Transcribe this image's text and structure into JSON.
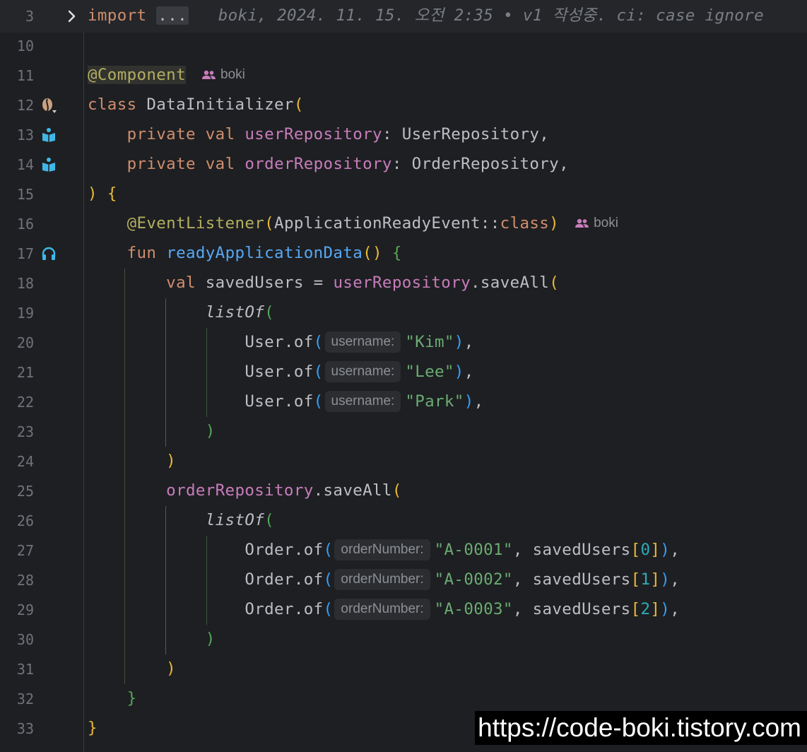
{
  "fold": {
    "line_number": "3",
    "keyword": "import",
    "dots": "...",
    "blame": "boki, 2024. 11. 15. 오전 2:35 • v1 작성중. ci: case ignore"
  },
  "lines": {
    "l10": "10",
    "l11": "11",
    "l12": "12",
    "l13": "13",
    "l14": "14",
    "l15": "15",
    "l16": "16",
    "l17": "17",
    "l18": "18",
    "l19": "19",
    "l20": "20",
    "l21": "21",
    "l22": "22",
    "l23": "23",
    "l24": "24",
    "l25": "25",
    "l26": "26",
    "l27": "27",
    "l28": "28",
    "l29": "29",
    "l30": "30",
    "l31": "31",
    "l32": "32",
    "l33": "33"
  },
  "code": {
    "component_ann": "@Component",
    "author": "boki",
    "class_kw": "class",
    "class_name": "DataInitializer",
    "private_kw": "private",
    "val_kw": "val",
    "user_repo": "userRepository",
    "user_repo_type": "UserRepository",
    "order_repo": "orderRepository",
    "order_repo_type": "OrderRepository",
    "event_ann": "@EventListener",
    "event_class": "ApplicationReadyEvent",
    "double_colon": "::",
    "class_ref": "class",
    "fun_kw": "fun",
    "fun_name": "readyApplicationData",
    "saved_users": "savedUsers",
    "save_all": "saveAll",
    "list_of": "listOf",
    "user_of": "User.of",
    "order_of": "Order.of",
    "hint_username": "username:",
    "hint_order_number": "orderNumber:",
    "str_kim": "\"Kim\"",
    "str_lee": "\"Lee\"",
    "str_park": "\"Park\"",
    "str_a1": "\"A-0001\"",
    "str_a2": "\"A-0002\"",
    "str_a3": "\"A-0003\"",
    "idx0": "0",
    "idx1": "1",
    "idx2": "2"
  },
  "gutter_icons": {
    "line12": "spring-bean-icon",
    "line13": "injection-point-icon",
    "line14": "injection-point-icon",
    "line17": "event-listener-icon"
  },
  "colors": {
    "background": "#1e1f22",
    "keyword": "#cf8e6d",
    "annotation": "#b3ae60",
    "property": "#c77dbb",
    "function": "#56a8f5",
    "string": "#6aab73",
    "number": "#2aacb8"
  },
  "watermark": "https://code-boki.tistory.com"
}
